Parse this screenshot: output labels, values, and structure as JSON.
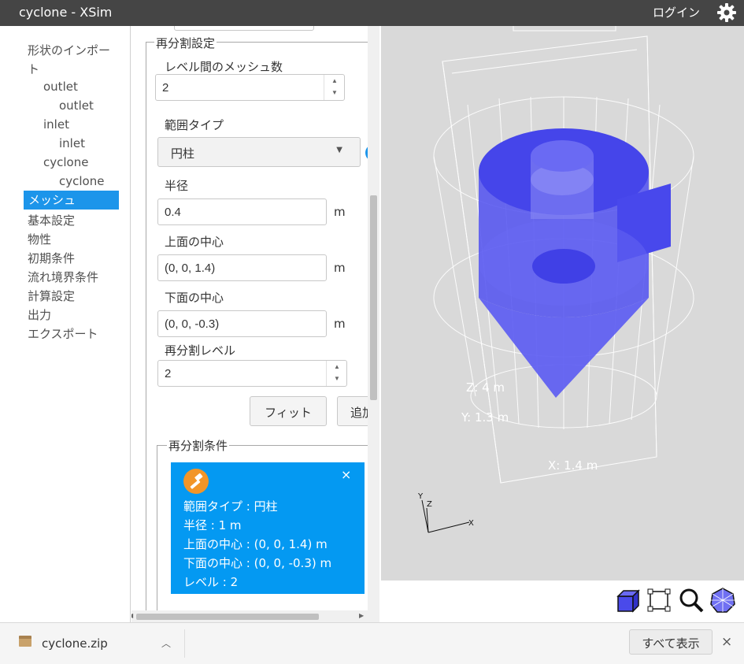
{
  "window": {
    "title": "cyclone - XSim",
    "login": "ログイン"
  },
  "sidebar": {
    "items": [
      {
        "label": "形状のインポー"
      },
      {
        "label": "ト"
      },
      {
        "label": "outlet"
      },
      {
        "label": "outlet"
      },
      {
        "label": "inlet"
      },
      {
        "label": "inlet"
      },
      {
        "label": "cyclone"
      },
      {
        "label": "cyclone"
      },
      {
        "label": "メッシュ",
        "active": true
      },
      {
        "label": "基本設定"
      },
      {
        "label": "物性"
      },
      {
        "label": "初期条件"
      },
      {
        "label": "流れ境界条件"
      },
      {
        "label": "計算設定"
      },
      {
        "label": "出力"
      },
      {
        "label": "エクスポート"
      }
    ]
  },
  "refine": {
    "legend": "再分割設定",
    "mesh_between_levels_label": "レベル間のメッシュ数",
    "mesh_between_levels_value": "2",
    "range_type_label": "範囲タイプ",
    "range_type_value": "円柱",
    "radius_label": "半径",
    "radius_value": "0.4",
    "top_center_label": "上面の中心",
    "top_center_value": "(0, 0, 1.4)",
    "bottom_center_label": "下面の中心",
    "bottom_center_value": "(0, 0, -0.3)",
    "level_label": "再分割レベル",
    "level_value": "2",
    "unit": "m",
    "fit_button": "フィット",
    "add_button": "追加"
  },
  "conditions": {
    "legend": "再分割条件",
    "card": {
      "lines": [
        "範囲タイプ : 円柱",
        "半径 : 1 m",
        "上面の中心 : (0, 0, 1.4) m",
        "下面の中心 : (0, 0, -0.3) m",
        "レベル : 2"
      ],
      "close": "×",
      "accent": "#0499f2",
      "badge_color": "#f29528"
    }
  },
  "viewer": {
    "dim_z": "Z: 4 m",
    "dim_y": "Y: 1.3 m",
    "dim_x": "X: 1.4 m",
    "axis_y": "Y",
    "axis_z": "Z",
    "axis_x": "X",
    "model_color": "#5050f0",
    "tools": [
      "cube-view-icon",
      "fit-bounds-icon",
      "zoom-icon",
      "wireframe-sphere-icon"
    ]
  },
  "downloads": {
    "file": "cyclone.zip",
    "show_all": "すべて表示",
    "close": "×"
  }
}
